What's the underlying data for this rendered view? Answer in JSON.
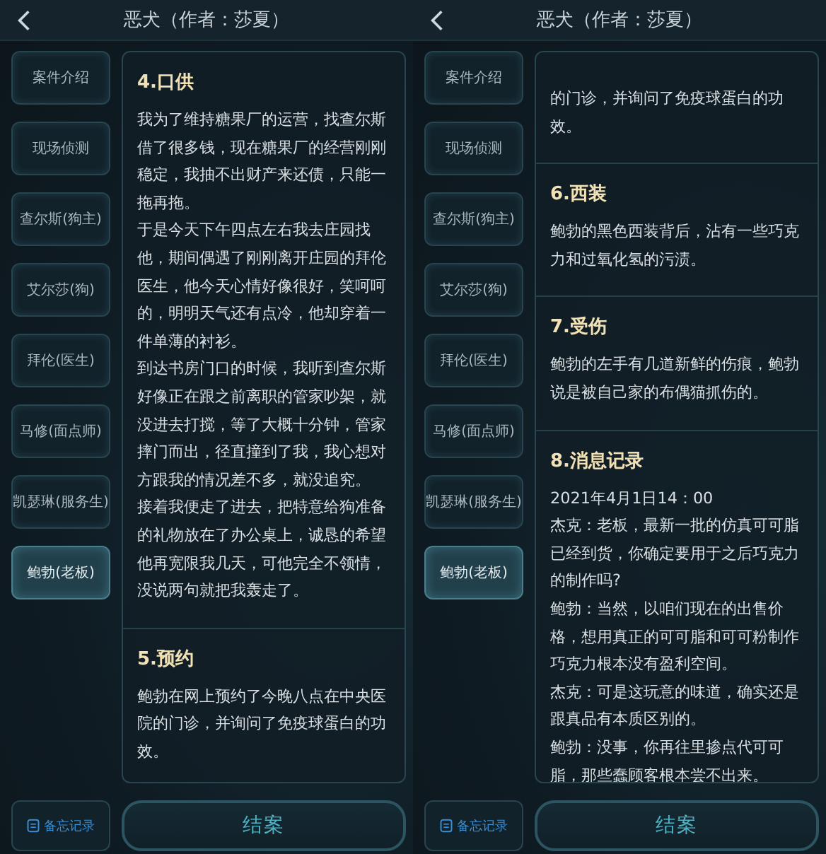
{
  "screens": [
    {
      "title": "恶犬（作者：莎夏）",
      "nav": [
        {
          "label": "案件介绍",
          "selected": false
        },
        {
          "label": "现场侦测",
          "selected": false
        },
        {
          "label": "查尔斯(狗主)",
          "selected": false
        },
        {
          "label": "艾尔莎(狗)",
          "selected": false
        },
        {
          "label": "拜伦(医生)",
          "selected": false
        },
        {
          "label": "马修(面点师)",
          "selected": false
        },
        {
          "label": "凯瑟琳(服务生)",
          "selected": false
        },
        {
          "label": "鲍勃(老板)",
          "selected": true
        }
      ],
      "sections": [
        {
          "heading": "4.口供",
          "paragraphs": [
            "我为了维持糖果厂的运营，找查尔斯借了很多钱，现在糖果厂的经营刚刚稳定，我抽不出财产来还债，只能一拖再拖。",
            "于是今天下午四点左右我去庄园找他，期间偶遇了刚刚离开庄园的拜伦医生，他今天心情好像很好，笑呵呵的，明明天气还有点冷，他却穿着一件单薄的衬衫。",
            "到达书房门口的时候，我听到查尔斯好像正在跟之前离职的管家吵架，就没进去打搅，等了大概十分钟，管家摔门而出，径直撞到了我，我心想对方跟我的情况差不多，就没追究。",
            "接着我便走了进去，把特意给狗准备的礼物放在了办公桌上，诚恳的希望他再宽限我几天，可他完全不领情，没说两句就把我轰走了。"
          ]
        },
        {
          "heading": "5.预约",
          "paragraphs": [
            "鲍勃在网上预约了今晚八点在中央医院的门诊，并询问了免疫球蛋白的功效。"
          ]
        }
      ],
      "memo_button": "备忘记录",
      "close_case_button": "结案"
    },
    {
      "title": "恶犬（作者：莎夏）",
      "nav": [
        {
          "label": "案件介绍",
          "selected": false
        },
        {
          "label": "现场侦测",
          "selected": false
        },
        {
          "label": "查尔斯(狗主)",
          "selected": false
        },
        {
          "label": "艾尔莎(狗)",
          "selected": false
        },
        {
          "label": "拜伦(医生)",
          "selected": false
        },
        {
          "label": "马修(面点师)",
          "selected": false
        },
        {
          "label": "凯瑟琳(服务生)",
          "selected": false
        },
        {
          "label": "鲍勃(老板)",
          "selected": true
        }
      ],
      "sections": [
        {
          "paragraphs": [
            "的门诊，并询问了免疫球蛋白的功效。"
          ]
        },
        {
          "heading": "6.西装",
          "paragraphs": [
            "鲍勃的黑色西装背后，沾有一些巧克力和过氧化氢的污渍。"
          ]
        },
        {
          "heading": "7.受伤",
          "paragraphs": [
            "鲍勃的左手有几道新鲜的伤痕，鲍勃说是被自己家的布偶猫抓伤的。"
          ]
        },
        {
          "heading": "8.消息记录",
          "paragraphs": [
            "2021年4月1日14：00",
            "杰克：老板，最新一批的仿真可可脂已经到货，你确定要用于之后巧克力的制作吗?",
            "鲍勃：当然，以咱们现在的出售价格，想用真正的可可脂和可可粉制作巧克力根本没有盈利空间。",
            "杰克：可是这玩意的味道，确实还是跟真品有本质区别的。",
            "鲍勃：没事，你再往里掺点代可可脂，那些蠢顾客根本尝不出来。"
          ]
        }
      ],
      "memo_button": "备忘记录",
      "close_case_button": "结案"
    }
  ]
}
